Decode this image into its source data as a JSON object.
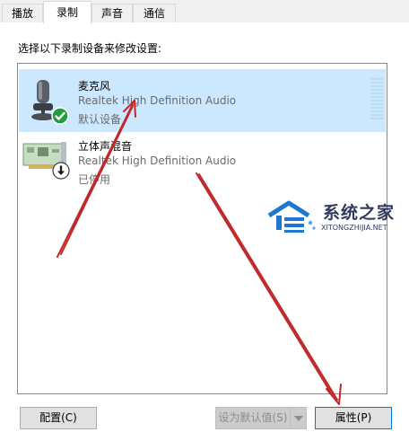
{
  "tabs": [
    {
      "label": "播放",
      "active": false
    },
    {
      "label": "录制",
      "active": true
    },
    {
      "label": "声音",
      "active": false
    },
    {
      "label": "通信",
      "active": false
    }
  ],
  "instruction": "选择以下录制设备来修改设置:",
  "devices": [
    {
      "name": "麦克风",
      "description": "Realtek High Definition Audio",
      "status": "默认设备",
      "icon": "microphone-icon",
      "badge": "green-check-icon",
      "selected": true
    },
    {
      "name": "立体声混音",
      "description": "Realtek High Definition Audio",
      "status": "已停用",
      "icon": "sound-card-icon",
      "badge": "down-arrow-disabled-icon",
      "selected": false
    }
  ],
  "buttons": {
    "configure": "配置(C)",
    "set_default": "设为默认值(S)",
    "properties": "属性(P)"
  },
  "watermark": {
    "title": "系统之家",
    "subtitle": "XITONGZHIJIA.NET"
  },
  "colors": {
    "selection": "#cce8ff",
    "annotation_arrow": "#c0282a",
    "check_badge": "#1e9e3c"
  }
}
